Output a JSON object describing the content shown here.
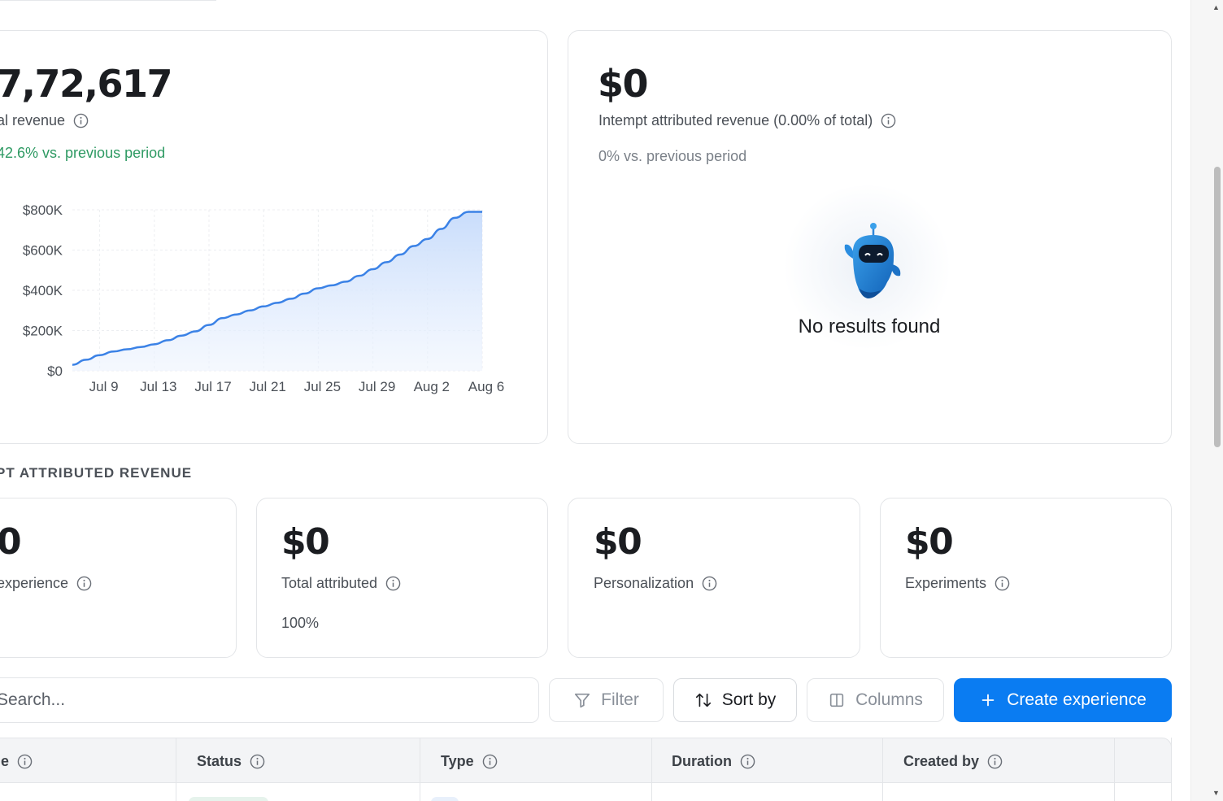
{
  "total_revenue": {
    "value": "7,72,617",
    "label": "al revenue",
    "delta": "42.6% vs. previous period"
  },
  "chart_data": {
    "type": "area",
    "x_ticks": [
      "Jul 9",
      "Jul 13",
      "Jul 17",
      "Jul 21",
      "Jul 25",
      "Jul 29",
      "Aug 2",
      "Aug 6"
    ],
    "y_ticks": [
      "$800K",
      "$600K",
      "$400K",
      "$200K",
      "$0"
    ],
    "ylim": [
      0,
      800000
    ],
    "x": [
      "Jul 7",
      "Jul 8",
      "Jul 9",
      "Jul 10",
      "Jul 11",
      "Jul 12",
      "Jul 13",
      "Jul 14",
      "Jul 15",
      "Jul 16",
      "Jul 17",
      "Jul 18",
      "Jul 19",
      "Jul 20",
      "Jul 21",
      "Jul 22",
      "Jul 23",
      "Jul 24",
      "Jul 25",
      "Jul 26",
      "Jul 27",
      "Jul 28",
      "Jul 29",
      "Jul 30",
      "Jul 31",
      "Aug 1",
      "Aug 2",
      "Aug 3",
      "Aug 4",
      "Aug 5",
      "Aug 6"
    ],
    "values": [
      30000,
      55000,
      78000,
      96000,
      107000,
      118000,
      132000,
      152000,
      175000,
      196000,
      228000,
      262000,
      280000,
      300000,
      320000,
      338000,
      358000,
      384000,
      410000,
      425000,
      443000,
      472000,
      505000,
      540000,
      578000,
      620000,
      655000,
      705000,
      760000,
      790000,
      790000
    ],
    "color": "#3b82e6",
    "grid": true
  },
  "attributed": {
    "value": "$0",
    "label": "Intempt attributed revenue (0.00% of total)",
    "delta": "0% vs. previous period",
    "empty_text": "No results found"
  },
  "section_title": "PT ATTRIBUTED REVENUE",
  "metrics": [
    {
      "value": "0",
      "label": "experience",
      "sub": ""
    },
    {
      "value": "$0",
      "label": "Total attributed",
      "sub": "100%"
    },
    {
      "value": "$0",
      "label": "Personalization",
      "sub": ""
    },
    {
      "value": "$0",
      "label": "Experiments",
      "sub": ""
    }
  ],
  "toolbar": {
    "search_placeholder": "Search...",
    "filter_label": "Filter",
    "sort_label": "Sort by",
    "columns_label": "Columns",
    "create_label": "Create experience"
  },
  "table": {
    "columns": [
      "e",
      "Status",
      "Type",
      "Duration",
      "Created by"
    ]
  },
  "colors": {
    "accent": "#0a7cf2",
    "positive": "#2e9a63",
    "chart_line": "#3b82e6"
  }
}
